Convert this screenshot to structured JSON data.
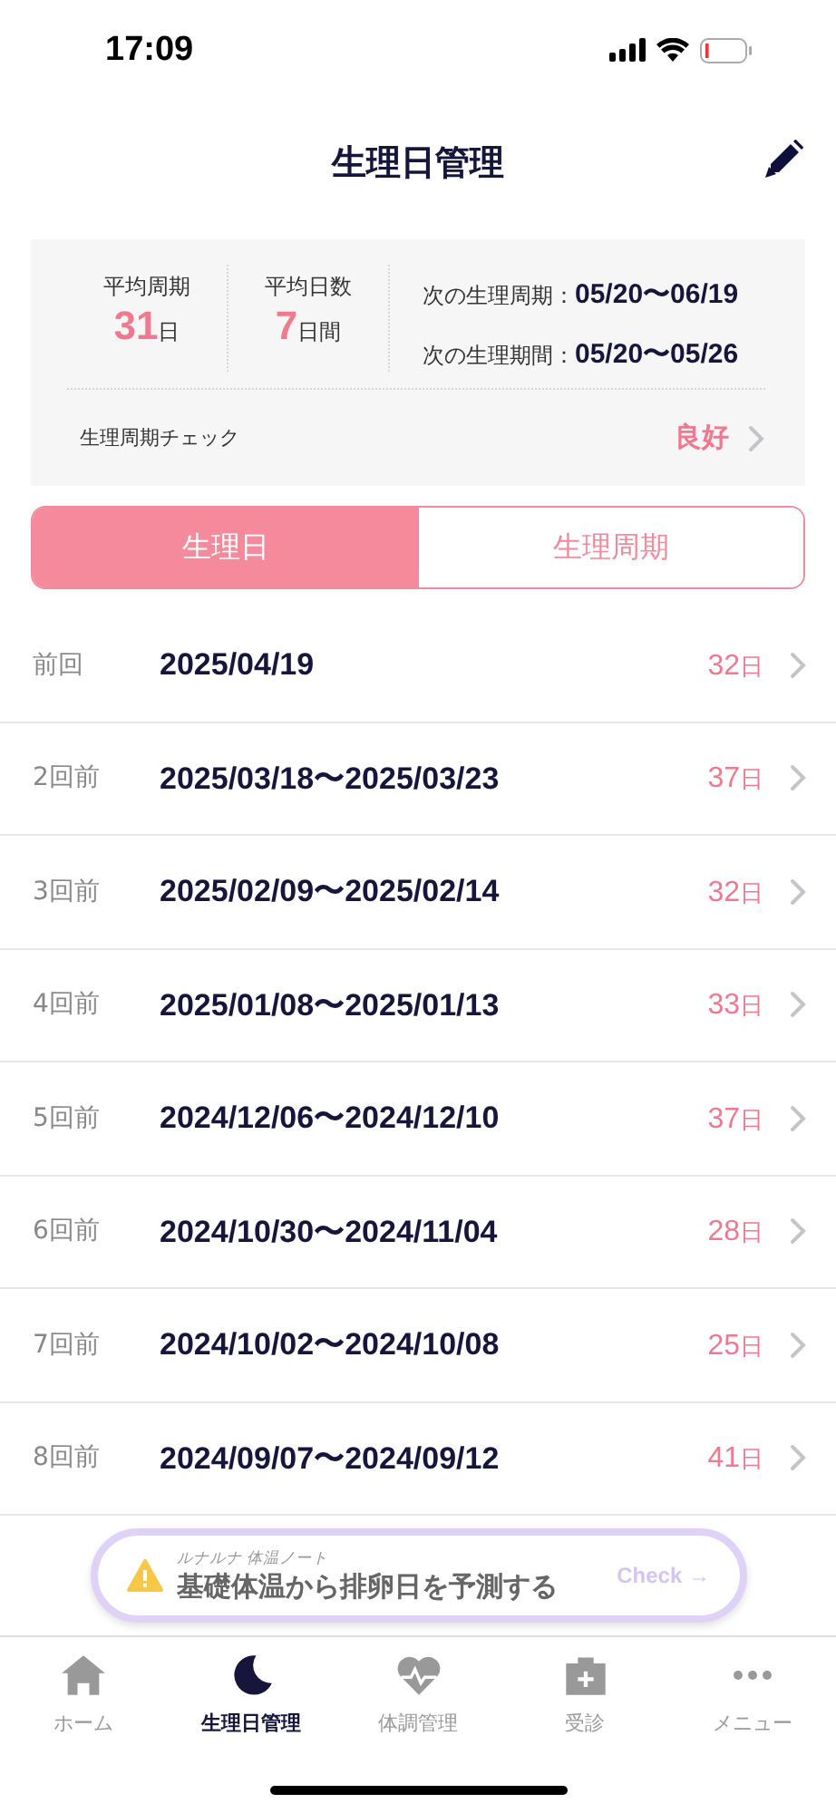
{
  "status_bar": {
    "time": "17:09"
  },
  "header": {
    "title": "生理日管理"
  },
  "summary": {
    "stats": [
      {
        "label": "平均周期",
        "value": "31",
        "unit": "日"
      },
      {
        "label": "平均日数",
        "value": "7",
        "unit": "日間"
      }
    ],
    "forecasts": [
      {
        "label": "次の生理周期：",
        "value": "05/20〜06/19"
      },
      {
        "label": "次の生理期間：",
        "value": "05/20〜05/26"
      }
    ],
    "check": {
      "label": "生理周期チェック",
      "value": "良好"
    }
  },
  "segments": [
    {
      "label": "生理日",
      "selected": true
    },
    {
      "label": "生理周期",
      "selected": false
    }
  ],
  "periods": [
    {
      "label": "前回",
      "dates": "2025/04/19",
      "days": "32",
      "unit": "日"
    },
    {
      "label": "2回前",
      "dates": "2025/03/18〜2025/03/23",
      "days": "37",
      "unit": "日"
    },
    {
      "label": "3回前",
      "dates": "2025/02/09〜2025/02/14",
      "days": "32",
      "unit": "日"
    },
    {
      "label": "4回前",
      "dates": "2025/01/08〜2025/01/13",
      "days": "33",
      "unit": "日"
    },
    {
      "label": "5回前",
      "dates": "2024/12/06〜2024/12/10",
      "days": "37",
      "unit": "日"
    },
    {
      "label": "6回前",
      "dates": "2024/10/30〜2024/11/04",
      "days": "28",
      "unit": "日"
    },
    {
      "label": "7回前",
      "dates": "2024/10/02〜2024/10/08",
      "days": "25",
      "unit": "日"
    },
    {
      "label": "8回前",
      "dates": "2024/09/07〜2024/09/12",
      "days": "41",
      "unit": "日"
    }
  ],
  "banner": {
    "caption": "ルナルナ 体温ノート",
    "text": "基礎体温から排卵日を予測する",
    "action": "Check →"
  },
  "tab_bar": [
    {
      "kind": "home",
      "label": "ホーム",
      "selected": false
    },
    {
      "kind": "moon",
      "label": "生理日管理",
      "selected": true
    },
    {
      "kind": "heart",
      "label": "体調管理",
      "selected": false
    },
    {
      "kind": "clinic",
      "label": "受診",
      "selected": false
    },
    {
      "kind": "more",
      "label": "メニュー",
      "selected": false
    }
  ]
}
